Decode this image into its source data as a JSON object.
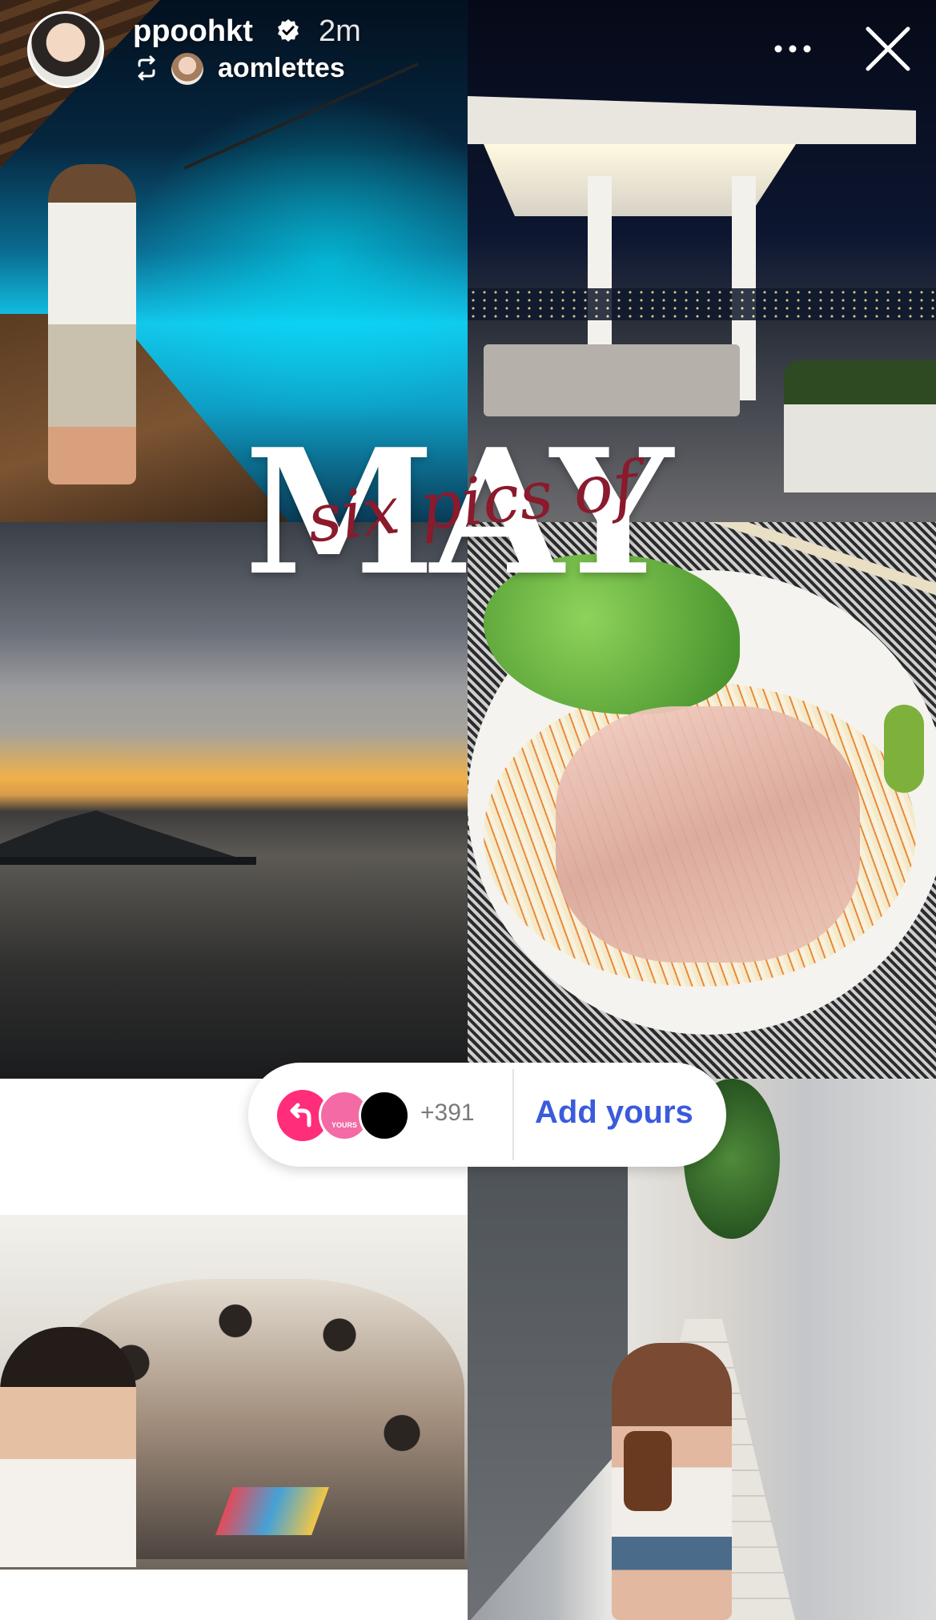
{
  "header": {
    "username": "ppoohkt",
    "time": "2m",
    "reposted_from": "aomlettes"
  },
  "sticker": {
    "script_text": "six pics of",
    "big_text": "MAY"
  },
  "add_yours": {
    "count": "+391",
    "yours_badge": "YOURS",
    "button_label": "Add yours"
  },
  "icons": [
    "verified-badge-icon",
    "repost-icon",
    "more-options-icon",
    "close-icon",
    "reply-arrow-icon"
  ],
  "colors": {
    "add_yours_accent": "#3b5bdb",
    "share_pink": "#ff2d7a",
    "script_maroon": "#8a1a2c"
  }
}
